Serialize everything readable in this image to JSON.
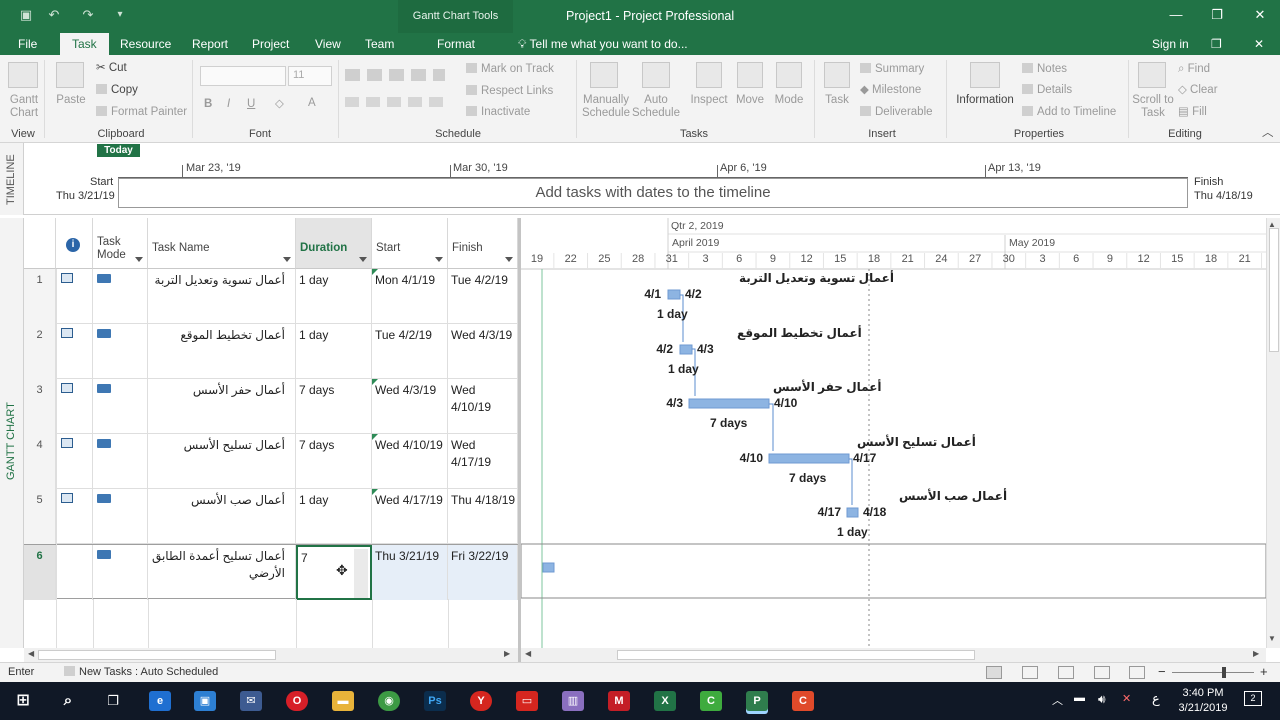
{
  "window": {
    "app_title": "Project1 - Project Professional",
    "context_tab_group": "Gantt Chart Tools",
    "controls": {
      "minimize": "—",
      "restore": "❐",
      "close": "✕"
    }
  },
  "tabs": [
    {
      "label": "File"
    },
    {
      "label": "Task"
    },
    {
      "label": "Resource"
    },
    {
      "label": "Report"
    },
    {
      "label": "Project"
    },
    {
      "label": "View"
    },
    {
      "label": "Team"
    },
    {
      "label": "Format"
    }
  ],
  "tell_me": "Tell me what you want to do...",
  "sign_in": "Sign in",
  "ribbon": {
    "view": {
      "gantt_chart": "Gantt Chart",
      "label": "View"
    },
    "clipboard": {
      "paste": "Paste",
      "cut": "Cut",
      "copy": "Copy",
      "format_painter": "Format Painter",
      "label": "Clipboard"
    },
    "font": {
      "size": "11",
      "bold": "B",
      "italic": "I",
      "underline": "U",
      "label": "Font"
    },
    "schedule": {
      "mark_on_track": "Mark on Track",
      "respect_links": "Respect Links",
      "inactivate": "Inactivate",
      "label": "Schedule"
    },
    "tasks": {
      "manually_schedule": "Manually Schedule",
      "auto_schedule": "Auto Schedule",
      "inspect": "Inspect",
      "move": "Move",
      "mode": "Mode",
      "label": "Tasks"
    },
    "insert": {
      "task": "Task",
      "summary": "Summary",
      "milestone": "Milestone",
      "deliverable": "Deliverable",
      "label": "Insert"
    },
    "properties": {
      "information": "Information",
      "notes": "Notes",
      "details": "Details",
      "add_to_timeline": "Add to Timeline",
      "label": "Properties"
    },
    "editing": {
      "scroll_to_task": "Scroll to Task",
      "find": "Find",
      "clear": "Clear",
      "fill": "Fill",
      "label": "Editing"
    }
  },
  "timeline": {
    "side_label": "TIMELINE",
    "today": "Today",
    "start_label": "Start",
    "start_date": "Thu 3/21/19",
    "finish_label": "Finish",
    "finish_date": "Thu 4/18/19",
    "dates": [
      "Mar 23, '19",
      "Mar 30, '19",
      "Apr 6, '19",
      "Apr 13, '19"
    ],
    "placeholder": "Add tasks with dates to the timeline"
  },
  "gantt": {
    "side_label": "GANTT CHART",
    "columns": {
      "mode": "Task Mode",
      "name": "Task Name",
      "duration": "Duration",
      "start": "Start",
      "finish": "Finish"
    },
    "rows": [
      {
        "id": "1",
        "name": "أعمال تسوية وتعديل التربة",
        "duration": "1 day",
        "start": "Mon 4/1/19",
        "finish": "Tue 4/2/19"
      },
      {
        "id": "2",
        "name": "أعمال تخطيط الموقع",
        "duration": "1 day",
        "start": "Tue 4/2/19",
        "finish": "Wed 4/3/19"
      },
      {
        "id": "3",
        "name": "أعمال حفر الأسس",
        "duration": "7 days",
        "start": "Wed 4/3/19",
        "finish": "Wed 4/10/19"
      },
      {
        "id": "4",
        "name": "أعمال تسليح الأسس",
        "duration": "7 days",
        "start": "Wed 4/10/19",
        "finish": "Wed 4/17/19"
      },
      {
        "id": "5",
        "name": "أعمال صب الأسس",
        "duration": "1 day",
        "start": "Wed 4/17/19",
        "finish": "Thu 4/18/19"
      },
      {
        "id": "6",
        "name": "أعمال تسليح أعمدة الطابق الأرضي",
        "duration": "7",
        "start": "Thu 3/21/19",
        "finish": "Fri 3/22/19"
      }
    ],
    "chart_header": {
      "quarter": "Qtr 2, 2019",
      "months": [
        "April 2019",
        "May 2019"
      ],
      "days": [
        "19",
        "22",
        "25",
        "28",
        "31",
        "3",
        "6",
        "9",
        "12",
        "15",
        "18",
        "21",
        "24",
        "27",
        "30",
        "3",
        "6",
        "9",
        "12",
        "15",
        "18",
        "21"
      ]
    },
    "bars": [
      {
        "name": "أعمال تسوية وتعديل التربة",
        "start_label": "4/1",
        "finish_label": "4/2",
        "duration_label": "1 day"
      },
      {
        "name": "أعمال تخطيط الموقع",
        "start_label": "4/2",
        "finish_label": "4/3",
        "duration_label": "1 day"
      },
      {
        "name": "أعمال حفر الأسس",
        "start_label": "4/3",
        "finish_label": "4/10",
        "duration_label": "7 days"
      },
      {
        "name": "أعمال تسليح الأسس",
        "start_label": "4/10",
        "finish_label": "4/17",
        "duration_label": "7 days"
      },
      {
        "name": "أعمال صب الأسس",
        "start_label": "4/17",
        "finish_label": "4/18",
        "duration_label": "1 day"
      }
    ]
  },
  "status": {
    "mode": "Enter",
    "new_tasks": "New Tasks : Auto Scheduled"
  },
  "taskbar": {
    "time": "3:40 PM",
    "date": "3/21/2019",
    "lang": "ع"
  }
}
